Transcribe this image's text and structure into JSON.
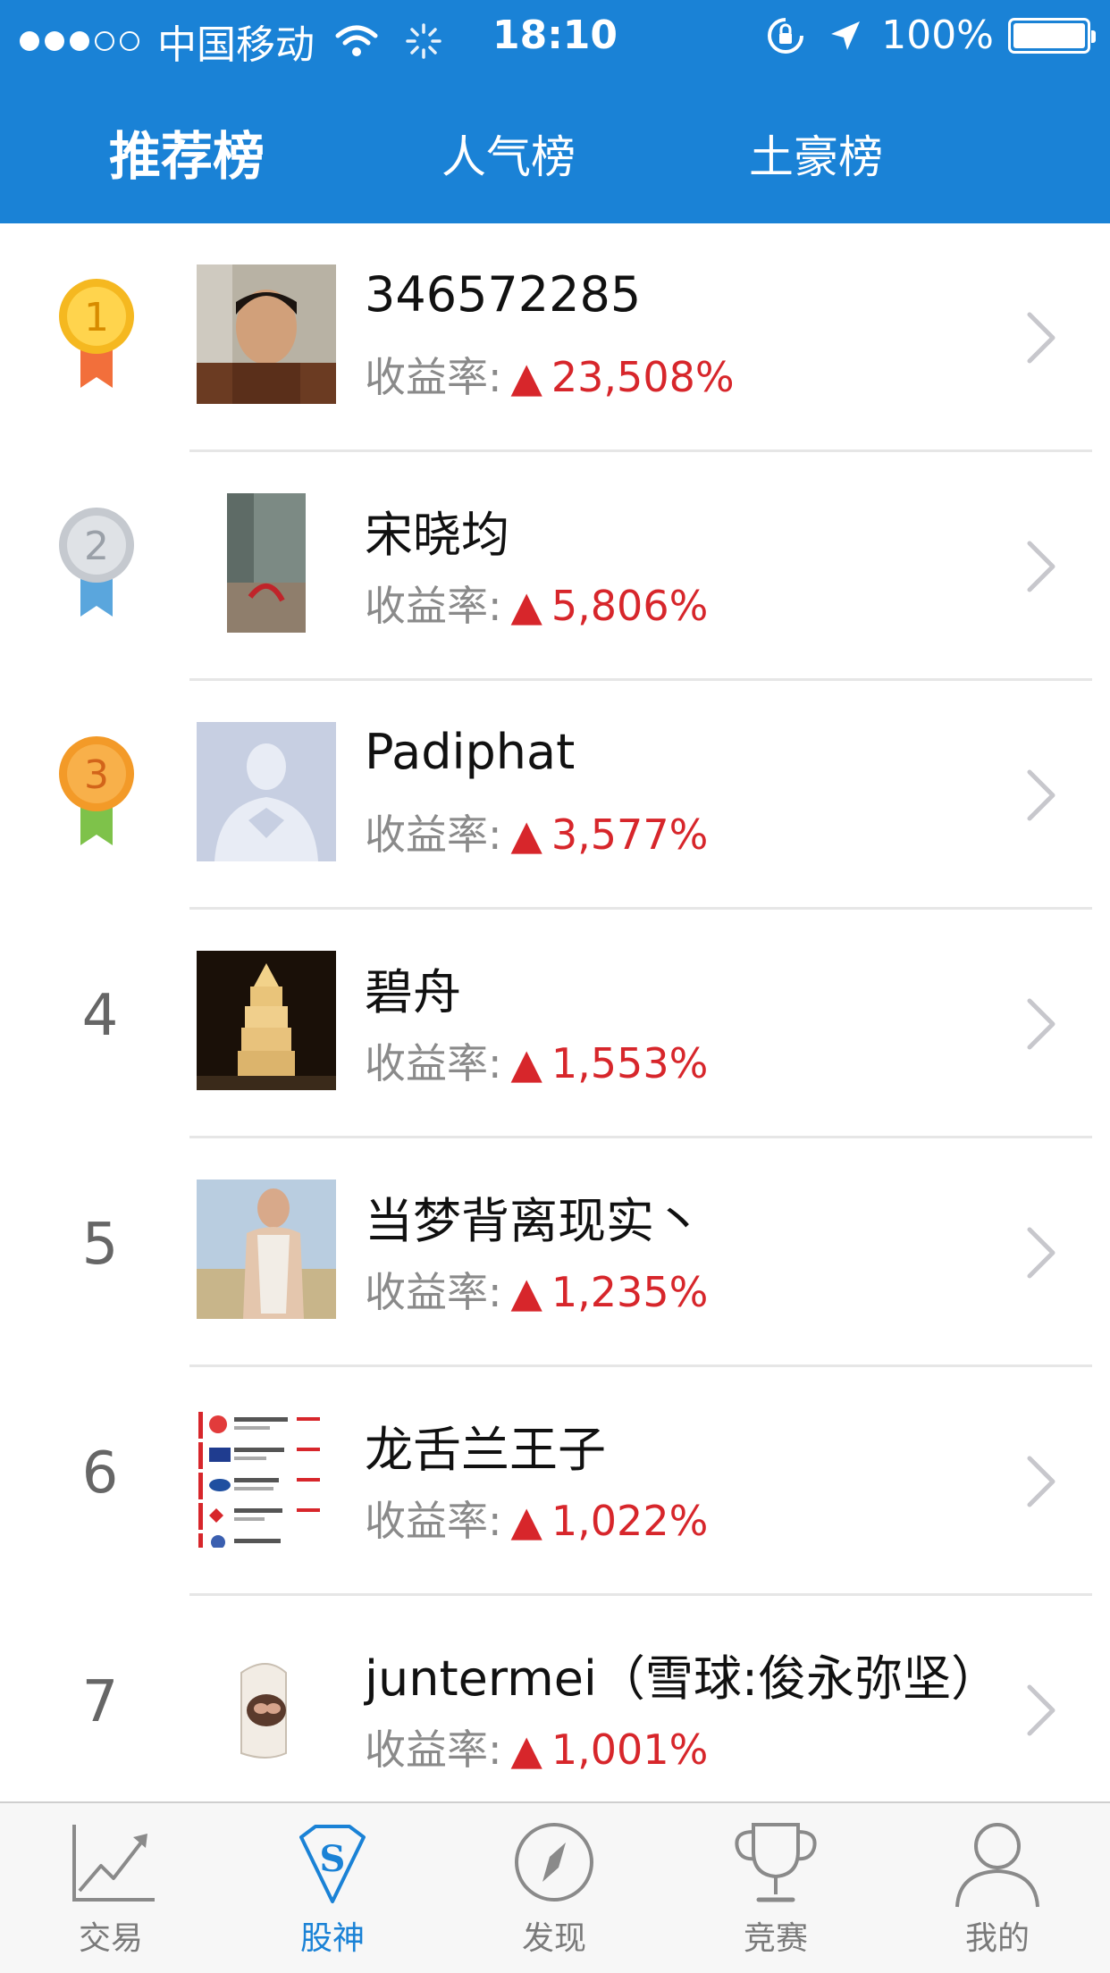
{
  "status_bar": {
    "carrier": "中国移动",
    "time": "18:10",
    "battery": "100%"
  },
  "tabs": [
    {
      "label": "推荐榜",
      "active": true
    },
    {
      "label": "人气榜",
      "active": false
    },
    {
      "label": "土豪榜",
      "active": false
    }
  ],
  "yield_label": "收益率:",
  "rankings": [
    {
      "rank": "1",
      "name": "346572285",
      "yield": "23,508%",
      "badge": "gold-medal"
    },
    {
      "rank": "2",
      "name": "宋晓均",
      "yield": "5,806%",
      "badge": "silver-medal"
    },
    {
      "rank": "3",
      "name": "Padiphat",
      "yield": "3,577%",
      "badge": "bronze-medal"
    },
    {
      "rank": "4",
      "name": "碧舟",
      "yield": "1,553%"
    },
    {
      "rank": "5",
      "name": "当梦背离现实丶",
      "yield": "1,235%"
    },
    {
      "rank": "6",
      "name": "龙舌兰王子",
      "yield": "1,022%"
    },
    {
      "rank": "7",
      "name": "juntermei（雪球:俊永弥坚）",
      "yield": "1,001%"
    }
  ],
  "tabbar": [
    {
      "label": "交易",
      "icon": "chart-trend-icon",
      "active": false
    },
    {
      "label": "股神",
      "icon": "superman-s-icon",
      "active": true
    },
    {
      "label": "发现",
      "icon": "compass-icon",
      "active": false
    },
    {
      "label": "竞赛",
      "icon": "trophy-icon",
      "active": false
    },
    {
      "label": "我的",
      "icon": "user-icon",
      "active": false
    }
  ],
  "colors": {
    "header": "#1a82d6",
    "gain": "#d7262b",
    "gold": "#f5b820",
    "silver": "#c5c9cf",
    "bronze": "#f39a28"
  }
}
